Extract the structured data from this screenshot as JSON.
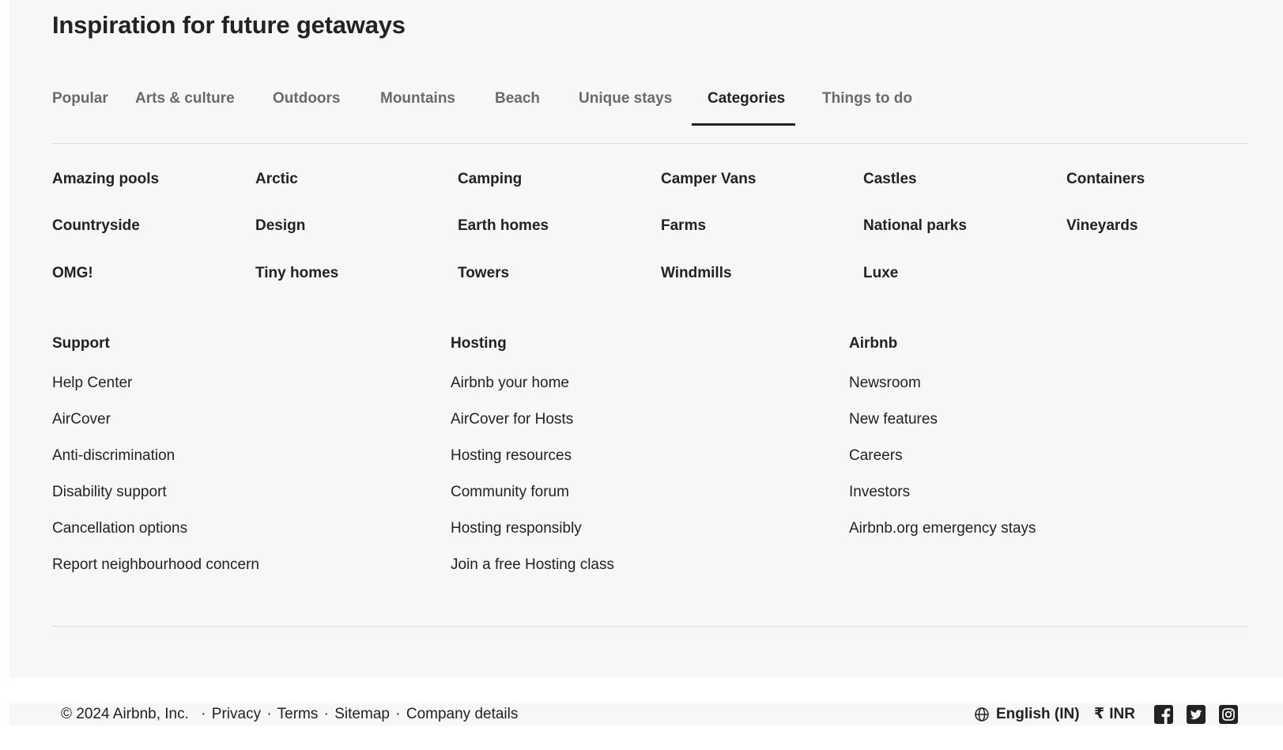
{
  "title": "Inspiration for future getaways",
  "tabs": [
    {
      "label": "Popular"
    },
    {
      "label": "Arts & culture"
    },
    {
      "label": "Outdoors"
    },
    {
      "label": "Mountains"
    },
    {
      "label": "Beach"
    },
    {
      "label": "Unique stays"
    },
    {
      "label": "Categories"
    },
    {
      "label": "Things to do"
    }
  ],
  "active_tab": "Categories",
  "categories": [
    "Amazing pools",
    "Arctic",
    "Camping",
    "Camper Vans",
    "Castles",
    "Containers",
    "Countryside",
    "Design",
    "Earth homes",
    "Farms",
    "National parks",
    "Vineyards",
    "OMG!",
    "Tiny homes",
    "Towers",
    "Windmills",
    "Luxe"
  ],
  "support": {
    "heading": "Support",
    "links": [
      "Help Center",
      "AirCover",
      "Anti-discrimination",
      "Disability support",
      "Cancellation options",
      "Report neighbourhood concern"
    ]
  },
  "hosting": {
    "heading": "Hosting",
    "links": [
      "Airbnb your home",
      "AirCover for Hosts",
      "Hosting resources",
      "Community forum",
      "Hosting responsibly",
      "Join a free Hosting class"
    ]
  },
  "airbnb": {
    "heading": "Airbnb",
    "links": [
      "Newsroom",
      "New features",
      "Careers",
      "Investors",
      "Airbnb.org emergency stays"
    ]
  },
  "legal": {
    "copyright": "© 2024 Airbnb, Inc.",
    "privacy": "Privacy",
    "terms": "Terms",
    "sitemap": "Sitemap",
    "company": "Company details",
    "separator": "·"
  },
  "tools": {
    "language": "English (IN)",
    "currency_symbol": "₹",
    "currency": "INR"
  },
  "icons": {
    "globe": "globe-icon",
    "facebook": "facebook-icon",
    "twitter": "twitter-icon",
    "instagram": "instagram-icon"
  },
  "colors": {
    "panel_bg": "#f7f7f7",
    "text": "#222222",
    "muted_tab": "#6a6a6a",
    "divider": "#dddddd"
  }
}
